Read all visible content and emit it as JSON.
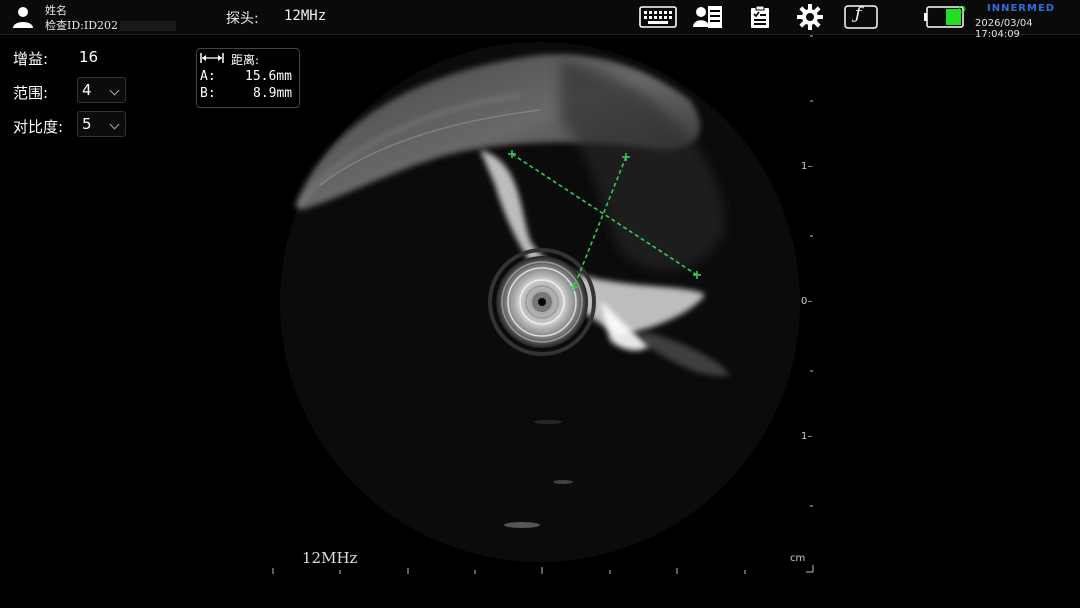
{
  "header": {
    "name_label": "姓名",
    "id_label": "检查ID:",
    "id_value": "ID202",
    "probe_label": "探头:",
    "probe_value": "12MHz",
    "brand": "INNERMED",
    "datetime": "2026/03/04 17:04:09"
  },
  "toolbar": {
    "buttons": [
      "keyboard-icon",
      "patient-info-icon",
      "report-icon",
      "settings-icon",
      "function-icon"
    ],
    "function_glyph": "ƒ"
  },
  "params": {
    "gain_label": "增益:",
    "gain_value": "16",
    "range_label": "范围:",
    "range_value": "4",
    "contrast_label": "对比度:",
    "contrast_value": "5"
  },
  "measurement": {
    "title": "距离:",
    "a_label": "A:",
    "a_value": "15.6mm",
    "b_label": "B:",
    "b_value": "8.9mm"
  },
  "scale": {
    "unit": "cm",
    "labels": [
      "1–",
      "0–",
      "1–"
    ],
    "frequency": "12MHz"
  },
  "colors": {
    "measure_line": "#33cc55",
    "battery": "#22dd22",
    "brand": "#2f6fd8"
  }
}
